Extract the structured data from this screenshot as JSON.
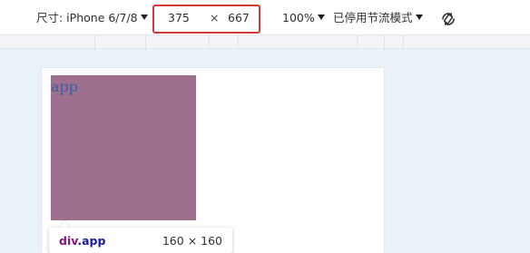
{
  "toolbar": {
    "device_label": "尺寸: iPhone 6/7/8",
    "width_value": "375",
    "times_symbol": "×",
    "height_value": "667",
    "zoom_label": "100%",
    "throttle_label": "已停用节流模式",
    "rotate_icon": "rotate-icon",
    "highlight_color": "#d63a38"
  },
  "viewport": {
    "element_text": "app",
    "element_color": "#9f6f8e"
  },
  "tooltip": {
    "tag": "div",
    "class": ".app",
    "size": "160 × 160"
  }
}
